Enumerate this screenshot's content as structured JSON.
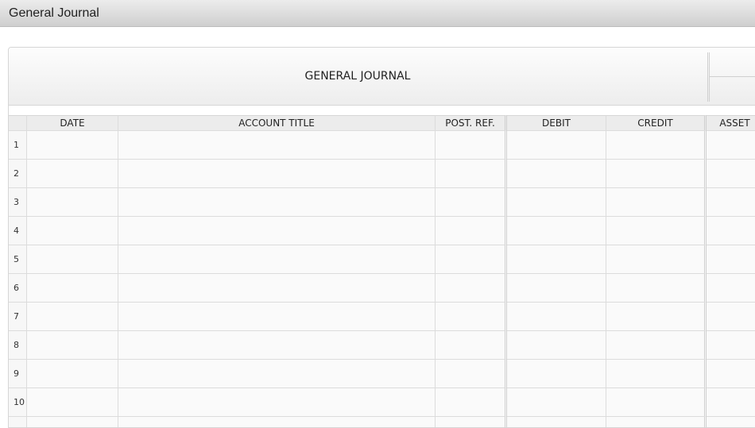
{
  "window": {
    "title": "General Journal"
  },
  "journal": {
    "heading": "GENERAL JOURNAL",
    "columns": [
      "DATE",
      "ACCOUNT TITLE",
      "POST. REF.",
      "DEBIT",
      "CREDIT",
      "ASSET"
    ],
    "rows": [
      "1",
      "2",
      "3",
      "4",
      "5",
      "6",
      "7",
      "8",
      "9",
      "10"
    ]
  }
}
